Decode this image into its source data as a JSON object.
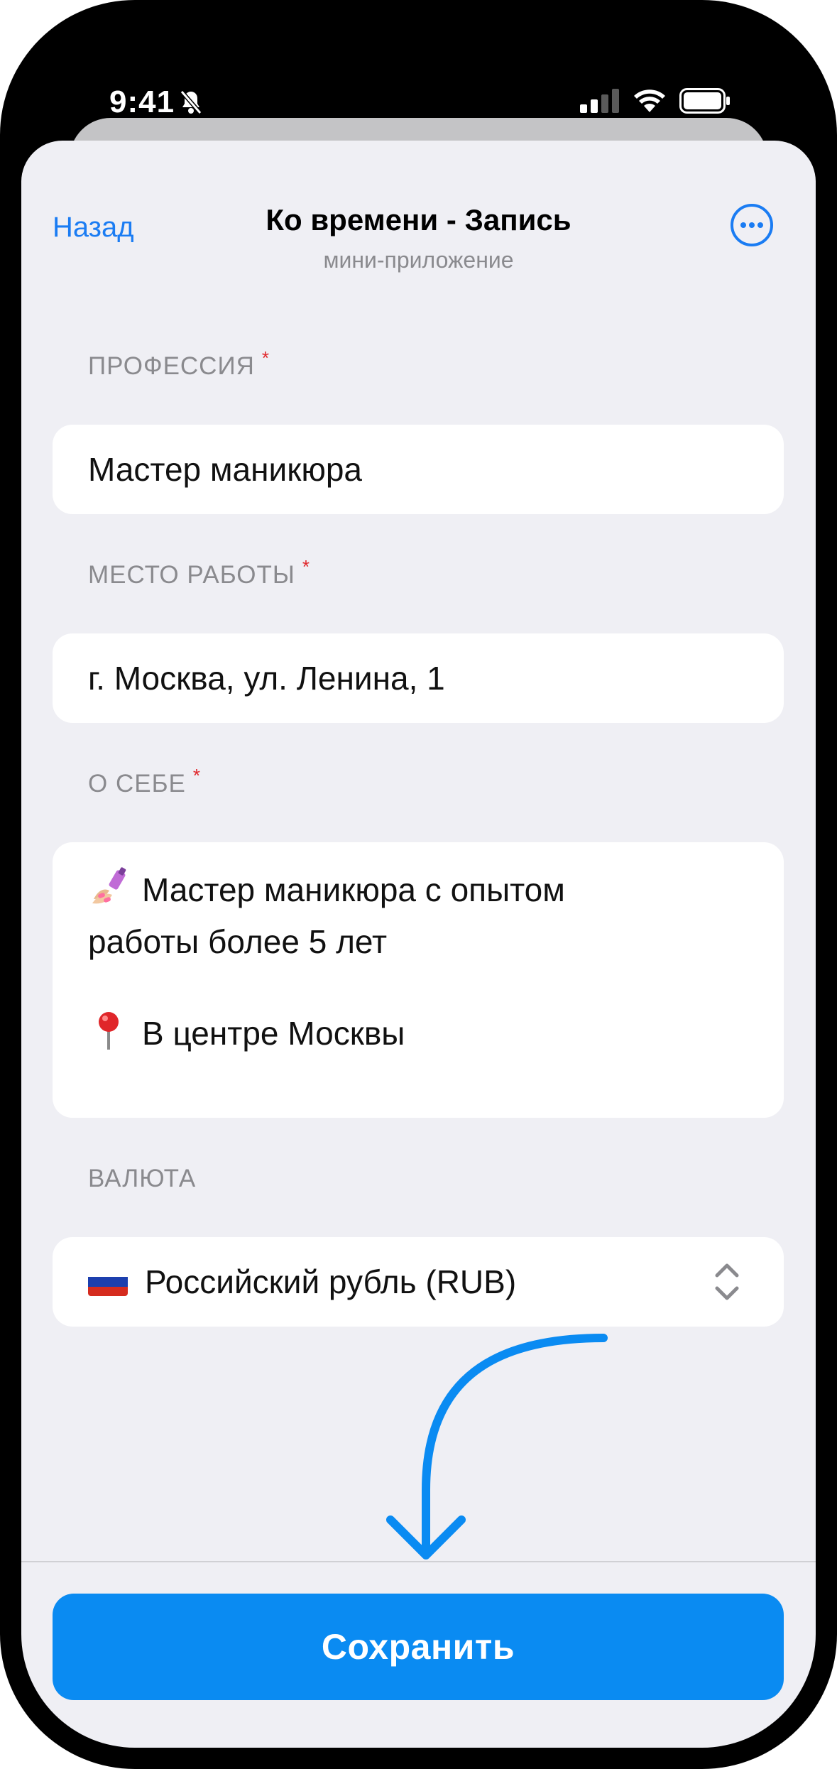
{
  "status_bar": {
    "time": "9:41"
  },
  "nav": {
    "back_label": "Назад",
    "title": "Ко времени - Запись",
    "subtitle": "мини-приложение"
  },
  "form": {
    "profession": {
      "label": "ПРОФЕССИЯ",
      "required_mark": "*",
      "value": "Мастер маникюра"
    },
    "workplace": {
      "label": "МЕСТО РАБОТЫ",
      "required_mark": "*",
      "value": "г. Москва, ул. Ленина, 1"
    },
    "about": {
      "label": "О СЕБЕ",
      "required_mark": "*",
      "line1": "Мастер маникюра с опытом",
      "line2": "работы более 5 лет",
      "line3": "В центре Москвы",
      "icon1": "nail-polish-emoji",
      "icon2": "pushpin-emoji"
    },
    "currency": {
      "label": "ВАЛЮТА",
      "value": "Российский рубль (RUB)",
      "icon": "russia-flag"
    }
  },
  "save_button": {
    "label": "Сохранить"
  },
  "colors": {
    "accent": "#0a8bf2",
    "link": "#1a7cf3",
    "background": "#efeff4",
    "required": "#e0262a"
  }
}
